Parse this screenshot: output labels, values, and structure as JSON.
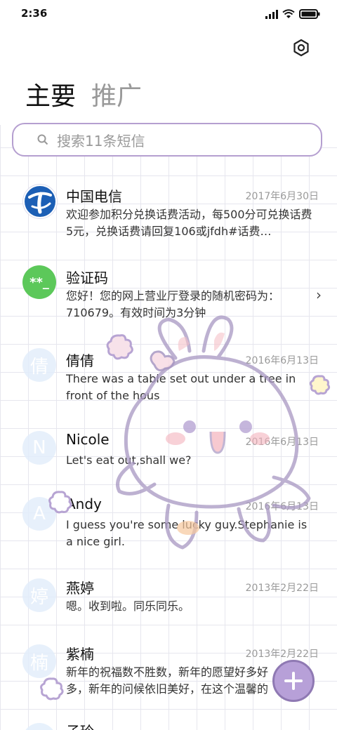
{
  "status_bar": {
    "time": "2:36"
  },
  "header": {
    "tabs": [
      {
        "label": "主要",
        "active": true
      },
      {
        "label": "推广",
        "active": false
      }
    ],
    "settings_icon": "gear-icon"
  },
  "search": {
    "placeholder": "搜索11条短信"
  },
  "conversations": [
    {
      "name": "中国电信",
      "date": "2017年6月30日",
      "preview": "欢迎参加积分兑换话费活动，每500分可兑换话费5元，兑换话费请回复106或jfdh#话费…",
      "avatar": "china-telecom-logo"
    },
    {
      "name": "验证码",
      "date": "",
      "preview": "您好！您的网上营业厅登录的随机密码为：710679。有效时间为3分钟",
      "avatar_text": "**_"
    },
    {
      "name": "倩倩",
      "date": "2016年6月13日",
      "preview": "There was a table set out under a tree in front of the hous",
      "avatar_text": "倩"
    },
    {
      "name": "Nicole",
      "date": "2016年6月13日",
      "preview": "Let's eat out,shall we?",
      "avatar_text": "N"
    },
    {
      "name": "Andy",
      "date": "2016年6月13日",
      "preview": "I guess you're some lucky guy.Stephanie is a nice girl.",
      "avatar_text": "A"
    },
    {
      "name": "燕婷",
      "date": "2013年2月22日",
      "preview": "嗯。收到啦。同乐同乐。",
      "avatar_text": "婷"
    },
    {
      "name": "紫楠",
      "date": "2013年2月22日",
      "preview": "新年的祝福数不胜数，新年的愿望好多好多，新年的问候依旧美好，在这个温馨的时刻",
      "avatar_text": "楠"
    },
    {
      "name": "子玲",
      "date": "",
      "preview": "",
      "avatar_text": ""
    }
  ],
  "fab": {
    "icon": "plus-icon"
  },
  "colors": {
    "accent": "#b59fd0",
    "telecom_blue": "#1c5fb5",
    "verify_green": "#5cc85a"
  }
}
